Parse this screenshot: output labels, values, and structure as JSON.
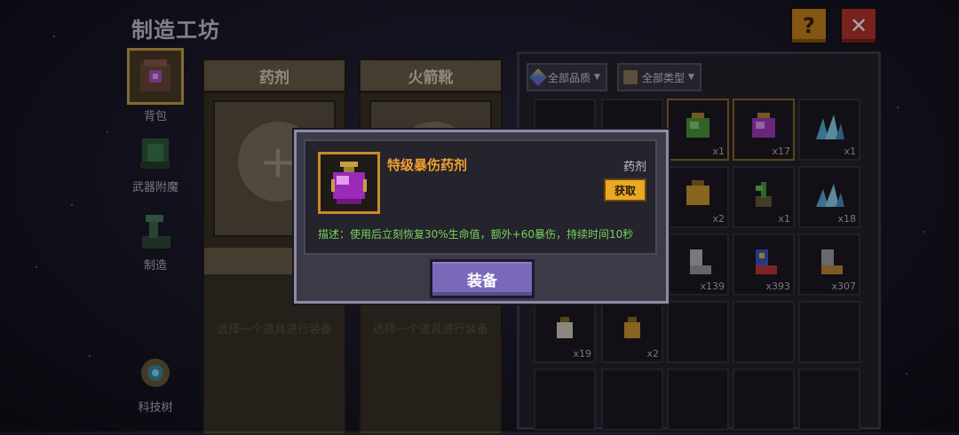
{
  "title": "制造工坊",
  "top_buttons": {
    "help_icon": "?",
    "close_icon": "✕"
  },
  "sidebar": {
    "items": [
      {
        "label": "背包",
        "icon": "backpack-icon",
        "active": true
      },
      {
        "label": "武器附魔",
        "icon": "enchant-icon",
        "active": false
      },
      {
        "label": "制造",
        "icon": "craft-icon",
        "active": false
      },
      {
        "label": "科技树",
        "icon": "tech-tree-icon",
        "active": false
      }
    ]
  },
  "slots": [
    {
      "header": "药剂",
      "hint": "选择一个道具进行装备",
      "plus": "+"
    },
    {
      "header": "火箭靴",
      "hint": "选择一个道具进行装备",
      "plus": "+"
    }
  ],
  "inventory": {
    "filters": {
      "quality": "全部品质",
      "type": "全部类型"
    },
    "counts": [
      "x1",
      "x17",
      "x1",
      "x2",
      "x1",
      "x18",
      "x139",
      "x393",
      "x307",
      "x19",
      "x2"
    ]
  },
  "modal": {
    "item_name": "特级暴伤药剂",
    "item_type": "药剂",
    "get_label": "获取",
    "description": "描述：使用后立刻恢复30%生命值，额外+60暴伤，持续时间10秒",
    "equip_label": "装备"
  },
  "colors": {
    "accent": "#f0a030",
    "desc": "#74d35a",
    "equip_button": "#7a68b8",
    "close": "#b8332d",
    "help": "#c98520"
  }
}
